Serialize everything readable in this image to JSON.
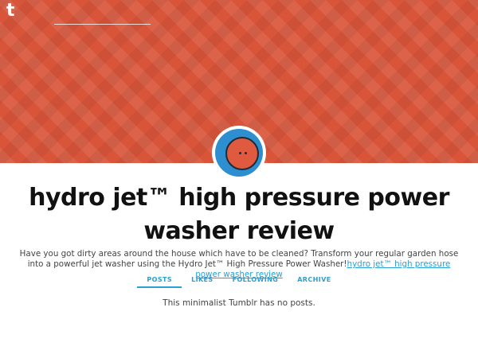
{
  "header": {
    "logo_letter": "t",
    "accent_color": "#d9553a"
  },
  "blog": {
    "title_line1": "hydro jet™ high pressure power",
    "title_line2": "washer review",
    "description": "Have you got dirty areas around the house which have to be cleaned? Transform your regular garden hose into a powerful jet washer using the Hydro Jet™ High Pressure Power Washer!",
    "description_link": "hydro jet™  high pressure power washer review",
    "link_color": "#2a9fd6"
  },
  "nav": {
    "items": [
      {
        "label": "POSTS"
      },
      {
        "label": "LIKES"
      },
      {
        "label": "FOLLOWING"
      },
      {
        "label": "ARCHIVE"
      }
    ]
  },
  "main": {
    "empty_message": "This minimalist Tumblr has no posts."
  },
  "icons": {
    "logo": "tumblr-logo-icon",
    "avatar": "avatar-face-icon"
  }
}
